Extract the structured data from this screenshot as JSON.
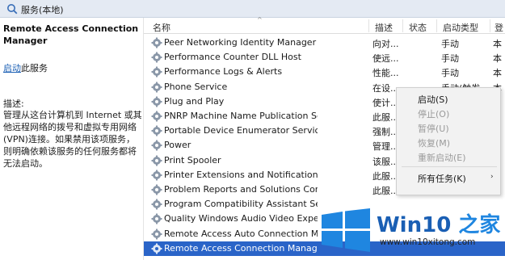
{
  "window": {
    "title": "服务(本地)",
    "title_icon": "search-icon"
  },
  "left_panel": {
    "service_name": "Remote Access Connection Manager",
    "start_link": "启动",
    "start_suffix": "此服务",
    "desc_label": "描述:",
    "description": "管理从这台计算机到 Internet 或其他远程网络的拨号和虚拟专用网络(VPN)连接。如果禁用该项服务，则明确依赖该服务的任何服务都将无法启动。"
  },
  "columns": {
    "name": "名称",
    "description": "描述",
    "status": "状态",
    "startup": "启动类型",
    "logon": "登"
  },
  "rows": [
    {
      "name": "Peer Networking Identity Manager",
      "desc": "向对...",
      "start": "手动",
      "logon": "本"
    },
    {
      "name": "Performance Counter DLL Host",
      "desc": "使远...",
      "start": "手动",
      "logon": "本"
    },
    {
      "name": "Performance Logs & Alerts",
      "desc": "性能...",
      "start": "手动",
      "logon": "本"
    },
    {
      "name": "Phone Service",
      "desc": "在设...",
      "start": "手动(触发...",
      "logon": "本"
    },
    {
      "name": "Plug and Play",
      "desc": "使计...",
      "start": "",
      "logon": ""
    },
    {
      "name": "PNRP Machine Name Publication Service",
      "desc": "此服...",
      "start": "",
      "logon": ""
    },
    {
      "name": "Portable Device Enumerator Service",
      "desc": "强制...",
      "start": "",
      "logon": ""
    },
    {
      "name": "Power",
      "desc": "管理...",
      "start": "",
      "logon": ""
    },
    {
      "name": "Print Spooler",
      "desc": "该服...",
      "start": "",
      "logon": ""
    },
    {
      "name": "Printer Extensions and Notifications",
      "desc": "此服...",
      "start": "",
      "logon": ""
    },
    {
      "name": "Problem Reports and Solutions Control Panel S...",
      "desc": "此服...",
      "start": "",
      "logon": ""
    },
    {
      "name": "Program Compatibility Assistant Serv...",
      "desc": "",
      "start": "",
      "logon": ""
    },
    {
      "name": "Quality Windows Audio Video Experi...",
      "desc": "",
      "start": "",
      "logon": ""
    },
    {
      "name": "Remote Access Auto Connection Ma...",
      "desc": "",
      "start": "",
      "logon": ""
    },
    {
      "name": "Remote Access Connection Manager",
      "desc": "",
      "start": "",
      "logon": ""
    }
  ],
  "selected_row": 14,
  "context_menu": {
    "items": [
      {
        "label": "启动(S)",
        "enabled": true
      },
      {
        "label": "停止(O)",
        "enabled": false
      },
      {
        "label": "暂停(U)",
        "enabled": false
      },
      {
        "label": "恢复(M)",
        "enabled": false
      },
      {
        "label": "重新启动(E)",
        "enabled": false
      },
      {
        "label": "所有任务(K)",
        "enabled": true,
        "submenu": true
      }
    ],
    "submenu_icon": "chevron-right-icon"
  },
  "watermark": {
    "brand_prefix": "Win10",
    "brand_suffix": "之家",
    "url": "www.win10xitong.com",
    "logo_icon": "windows-logo-icon"
  },
  "colors": {
    "accent": "#2a64c8",
    "link": "#1a5fb4",
    "logo": "#1f86e0"
  }
}
